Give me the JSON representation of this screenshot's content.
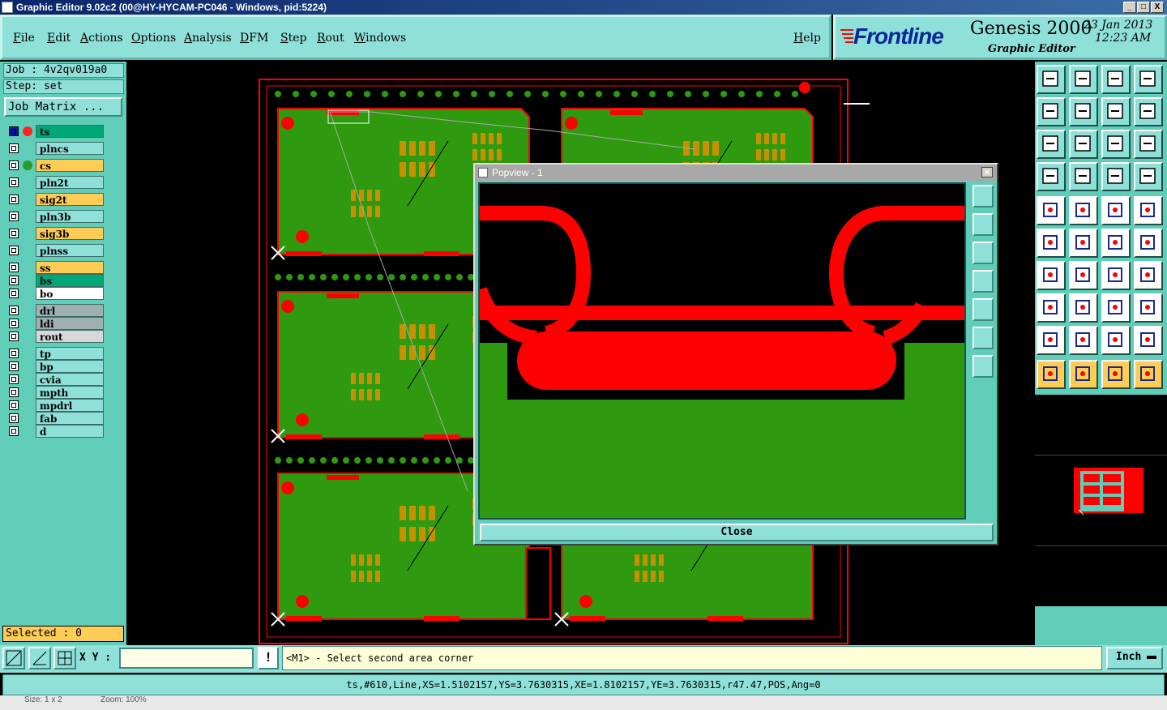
{
  "window": {
    "title": "Graphic Editor 9.02c2 (00@HY-HYCAM-PC046 - Windows, pid:5224)",
    "buttons": [
      "_",
      "□",
      "X"
    ]
  },
  "menu": [
    "File",
    "Edit",
    "Actions",
    "Options",
    "Analysis",
    "DFM",
    "Step",
    "Rout",
    "Windows"
  ],
  "help": "Help",
  "brand": {
    "logo": "Frontline",
    "product": "Genesis 2000",
    "subtitle": "Graphic Editor",
    "date": "23 Jan 2013",
    "time": "12:23 AM"
  },
  "job": {
    "job_label": "Job : 4v2qv019a0",
    "step_label": "Step: set",
    "matrix_button": "Job Matrix ..."
  },
  "layers": [
    {
      "name": "ts",
      "color": "#00a878",
      "dot": "#ff2020",
      "active": true
    },
    {
      "name": "plncs",
      "color": "#8fe0d8"
    },
    {
      "name": "cs",
      "color": "#ffcc55",
      "dot": "#2a9a2a"
    },
    {
      "name": "pln2t",
      "color": "#8fe0d8"
    },
    {
      "name": "sig2t",
      "color": "#ffcc55"
    },
    {
      "name": "pln3b",
      "color": "#8fe0d8"
    },
    {
      "name": "sig3b",
      "color": "#ffcc55"
    },
    {
      "name": "plnss",
      "color": "#8fe0d8"
    },
    {
      "name": "ss",
      "color": "#ffcc55"
    },
    {
      "name": "bs",
      "color": "#00a878"
    },
    {
      "name": "bo",
      "color": "#ffffff"
    },
    {
      "name": "drl",
      "color": "#a0b0b0"
    },
    {
      "name": "ldi",
      "color": "#a0b0b0"
    },
    {
      "name": "rout",
      "color": "#d8d8d8"
    },
    {
      "name": "tp",
      "color": "#8fe0d8"
    },
    {
      "name": "bp",
      "color": "#8fe0d8"
    },
    {
      "name": "cvia",
      "color": "#8fe0d8"
    },
    {
      "name": "mpth",
      "color": "#8fe0d8"
    },
    {
      "name": "mpdrl",
      "color": "#8fe0d8"
    },
    {
      "name": "fab",
      "color": "#8fe0d8"
    },
    {
      "name": "d",
      "color": "#8fe0d8"
    }
  ],
  "selected": "Selected : 0",
  "popview": {
    "title": "Popview - 1",
    "close_button": "Close"
  },
  "bottom": {
    "xy_label": "X Y :",
    "xy_value": "",
    "prompt": "<M1> - Select second area corner",
    "units": "Inch",
    "status": "ts,#610,Line,XS=1.5102157,YS=3.7630315,XE=1.8102157,YE=3.7630315,r47.47,POS,Ang=0",
    "footer_left": "Size: 1 x 2",
    "footer_zoom": "Zoom: 100%"
  },
  "colors": {
    "board_green": "#2f9a10",
    "copper_red": "#ff0000",
    "pad_orange": "#c89000",
    "panel_teal": "#5fcdb8",
    "button_teal": "#8fe0d8"
  }
}
